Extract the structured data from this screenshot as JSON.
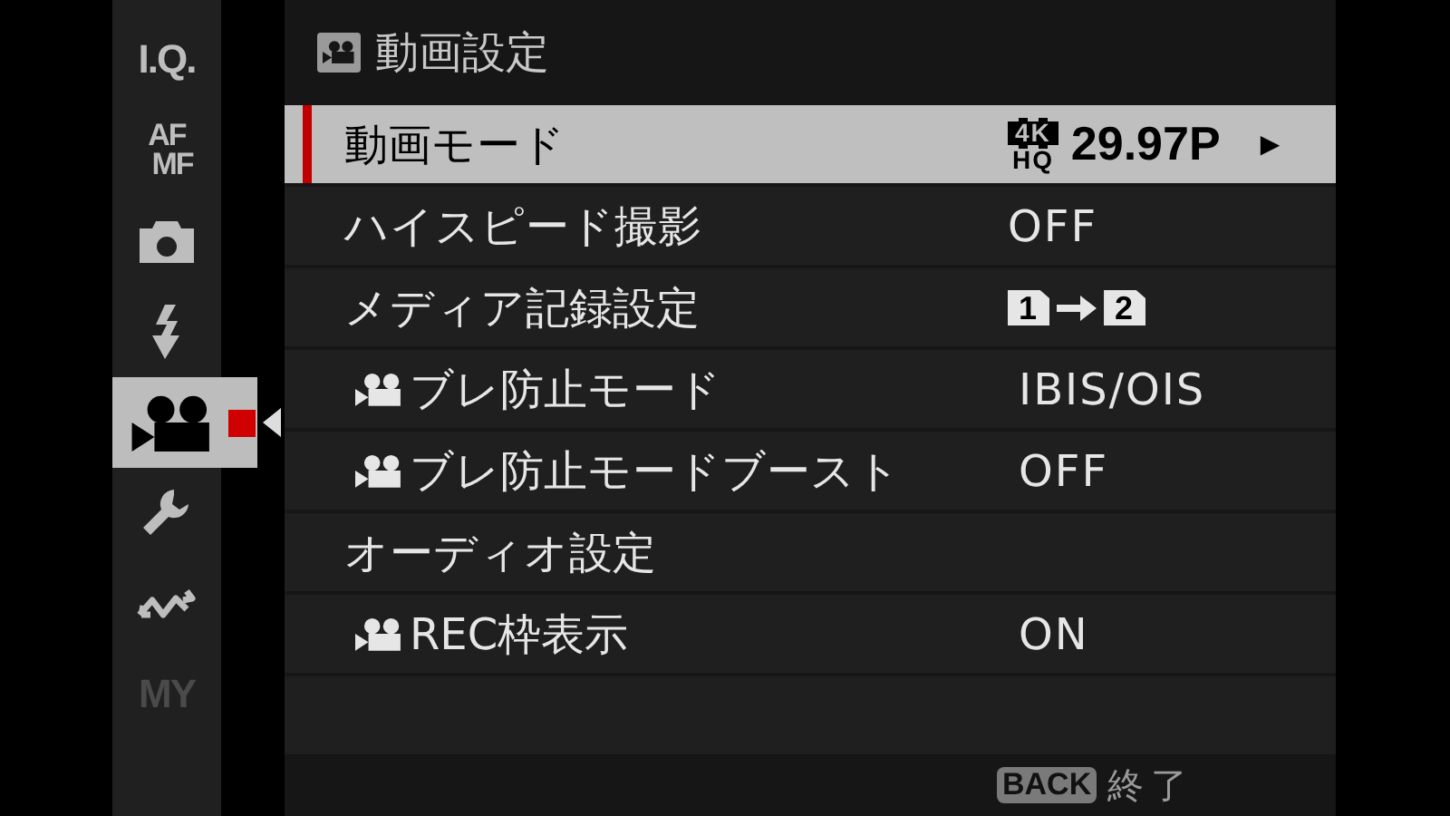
{
  "sidebar": {
    "items": [
      {
        "kind": "text",
        "lines": [
          "I.Q."
        ],
        "selected": false,
        "disabled": false
      },
      {
        "kind": "text",
        "lines": [
          "AF",
          "MF"
        ],
        "selected": false,
        "disabled": false
      },
      {
        "kind": "camera",
        "selected": false,
        "disabled": false
      },
      {
        "kind": "flash",
        "selected": false,
        "disabled": false
      },
      {
        "kind": "movie",
        "selected": true,
        "disabled": false
      },
      {
        "kind": "wrench",
        "selected": false,
        "disabled": false
      },
      {
        "kind": "connection",
        "selected": false,
        "disabled": false
      },
      {
        "kind": "text",
        "lines": [
          "MY"
        ],
        "selected": false,
        "disabled": true
      }
    ]
  },
  "menu": {
    "title": "動画設定",
    "rows": [
      {
        "label": "動画モード",
        "movie_icon": false,
        "selected": true,
        "value": {
          "kind": "quality",
          "badge_top": "4K",
          "badge_bottom": "HQ",
          "text": "29.97P",
          "arrow": "▶"
        }
      },
      {
        "label": "ハイスピード撮影",
        "movie_icon": false,
        "selected": false,
        "value": {
          "kind": "text",
          "text": "OFF"
        }
      },
      {
        "label": "メディア記録設定",
        "movie_icon": false,
        "selected": false,
        "value": {
          "kind": "cards",
          "from": "1",
          "to": "2"
        }
      },
      {
        "label": "ブレ防止モード",
        "movie_icon": true,
        "selected": false,
        "value": {
          "kind": "text",
          "text": "IBIS/OIS"
        }
      },
      {
        "label": "ブレ防止モードブースト",
        "movie_icon": true,
        "selected": false,
        "value": {
          "kind": "text",
          "text": "OFF"
        }
      },
      {
        "label": "オーディオ設定",
        "movie_icon": false,
        "selected": false
      },
      {
        "label": "REC枠表示",
        "movie_icon": true,
        "selected": false,
        "value": {
          "kind": "text",
          "text": "ON"
        }
      }
    ],
    "footer": {
      "key": "BACK",
      "label": "終了"
    }
  }
}
